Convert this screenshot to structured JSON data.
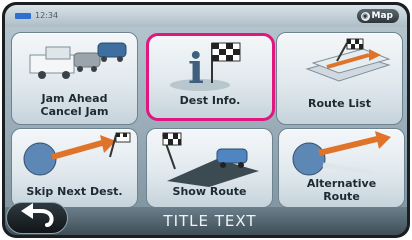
{
  "status_bar": {
    "time": "12:34",
    "map_button": "Map"
  },
  "tiles": [
    {
      "label": "Jam Ahead\nCancel Jam"
    },
    {
      "label": "Dest Info."
    },
    {
      "label": "Route List"
    },
    {
      "label": "Skip Next Dest."
    },
    {
      "label": "Show Route"
    },
    {
      "label": "Alternative\nRoute"
    }
  ],
  "title_text": "TITLE TEXT",
  "colors": {
    "highlight": "#e0177f",
    "tile": "#e1e9ee",
    "battery": "#2f6fd0"
  },
  "icons": [
    "battery-icon",
    "globe-icon",
    "traffic-jam-icon",
    "info-flag-icon",
    "route-list-icon",
    "skip-destination-icon",
    "show-route-car-icon",
    "alternative-route-icon",
    "back-arrow-icon"
  ]
}
